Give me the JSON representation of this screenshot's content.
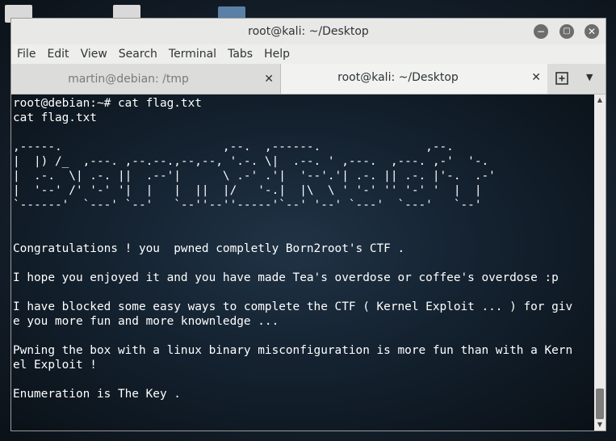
{
  "window": {
    "title": "root@kali: ~/Desktop",
    "buttons": {
      "minimize": "−",
      "maximize": "▢",
      "close": "✕"
    }
  },
  "menu": [
    "File",
    "Edit",
    "View",
    "Search",
    "Terminal",
    "Tabs",
    "Help"
  ],
  "tabs": [
    {
      "label": "martin@debian: /tmp",
      "close": "✕",
      "active": false
    },
    {
      "label": "root@kali: ~/Desktop",
      "close": "✕",
      "active": true
    }
  ],
  "terminal": {
    "prompt_line": "root@debian:~# cat flag.txt",
    "echo_line": "cat flag.txt",
    "ascii_art": [
      ",-----.                       ,--.  ,------.               ,--.",
      "|  |) /_  ,---. ,--.--.,--,--, '.-. \\|  .--. ' ,---.  ,---. ,-'  '-.",
      "|  .-.  \\| .-. ||  .--'|      \\ .-' .'|  '--'.'| .-. || .-. |'-.  .-'",
      "|  '--' /' '-' '|  |   |  ||  |/   '-.|  |\\  \\ ' '-' '' '-' '  |  |",
      "`------'  `---' `--'   `--''--''-----'`--' '--' `---'  `---'   `--'"
    ],
    "message_lines": [
      "Congratulations ! you  pwned completly Born2root's CTF .",
      "",
      "I hope you enjoyed it and you have made Tea's overdose or coffee's overdose :p",
      "",
      "I have blocked some easy ways to complete the CTF ( Kernel Exploit ... ) for giv",
      "e you more fun and more knownledge ...",
      "",
      "Pwning the box with a linux binary misconfiguration is more fun than with a Kern",
      "el Exploit !",
      "",
      "Enumeration is The Key ."
    ]
  },
  "colors": {
    "terminal_text": "#ffffff",
    "window_chrome": "#eeeeec"
  },
  "icons": [
    "minimize-icon",
    "maximize-icon",
    "close-icon",
    "new-tab-icon",
    "tab-menu-chevron-icon"
  ]
}
